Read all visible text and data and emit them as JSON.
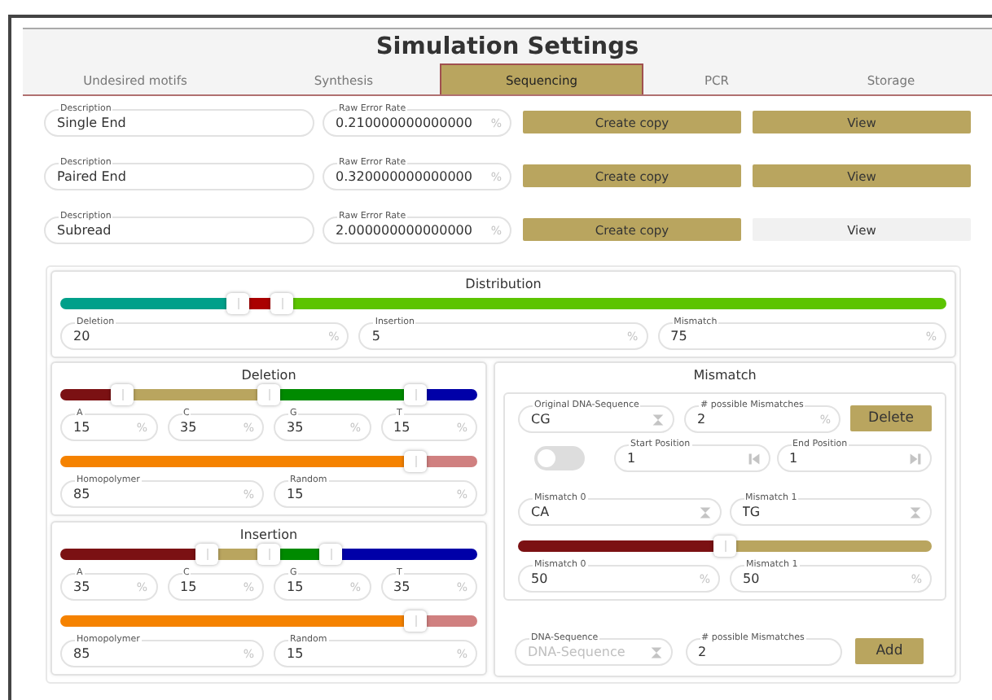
{
  "title": "Simulation Settings",
  "tabs": [
    {
      "label": "Undesired motifs",
      "selected": false
    },
    {
      "label": "Synthesis",
      "selected": false
    },
    {
      "label": "Sequencing",
      "selected": true
    },
    {
      "label": "PCR",
      "selected": false
    },
    {
      "label": "Storage",
      "selected": false
    }
  ],
  "methods": [
    {
      "description": {
        "label": "Description",
        "value": "Single End"
      },
      "error_rate": {
        "label": "Raw Error Rate",
        "value": "0.210000000000000",
        "unit": "%"
      },
      "copy_button": "Create copy",
      "view_button": {
        "label": "View",
        "disabled": false
      }
    },
    {
      "description": {
        "label": "Description",
        "value": "Paired End"
      },
      "error_rate": {
        "label": "Raw Error Rate",
        "value": "0.320000000000000",
        "unit": "%"
      },
      "copy_button": "Create copy",
      "view_button": {
        "label": "View",
        "disabled": false
      }
    },
    {
      "description": {
        "label": "Description",
        "value": "Subread"
      },
      "error_rate": {
        "label": "Raw Error Rate",
        "value": "2.000000000000000",
        "unit": "%"
      },
      "copy_button": "Create copy",
      "view_button": {
        "label": "View",
        "disabled": true
      }
    }
  ],
  "distribution": {
    "title": "Distribution",
    "track": [
      {
        "color": "#00a08a"
      },
      {
        "color": "#aa0000"
      },
      {
        "color": "#5cc400"
      }
    ],
    "handles": [
      {
        "level": 0.2
      },
      {
        "level": 0.25
      }
    ],
    "segments": [
      {
        "label": "Deletion",
        "value": "20",
        "unit": "%"
      },
      {
        "label": "Insertion",
        "value": "5",
        "unit": "%"
      },
      {
        "label": "Mismatch",
        "value": "75",
        "unit": "%"
      }
    ]
  },
  "deletion": {
    "title": "Deletion",
    "bars": [
      {
        "track": [
          {
            "color": "#7b1113"
          },
          {
            "color": "#b9a55f"
          },
          {
            "color": "#008a00"
          },
          {
            "color": "#0000a8"
          }
        ],
        "handles": [
          {
            "level": 0.15
          },
          {
            "level": 0.5
          },
          {
            "level": 0.85
          }
        ],
        "segments": [
          {
            "label": "A",
            "value": "15",
            "unit": "%"
          },
          {
            "label": "C",
            "value": "35",
            "unit": "%"
          },
          {
            "label": "G",
            "value": "35",
            "unit": "%"
          },
          {
            "label": "T",
            "value": "15",
            "unit": "%"
          }
        ]
      },
      {
        "track": [
          {
            "color": "#f58200"
          },
          {
            "color": "#d08080"
          }
        ],
        "handles": [
          {
            "level": 0.85
          }
        ],
        "segments": [
          {
            "label": "Homopolymer",
            "value": "85",
            "unit": "%"
          },
          {
            "label": "Random",
            "value": "15",
            "unit": "%"
          }
        ]
      }
    ]
  },
  "insertion": {
    "title": "Insertion",
    "bars": [
      {
        "track": [
          {
            "color": "#7b1113"
          },
          {
            "color": "#b9a55f"
          },
          {
            "color": "#008a00"
          },
          {
            "color": "#0000a8"
          }
        ],
        "handles": [
          {
            "level": 0.35
          },
          {
            "level": 0.5
          },
          {
            "level": 0.65
          }
        ],
        "segments": [
          {
            "label": "A",
            "value": "35",
            "unit": "%"
          },
          {
            "label": "C",
            "value": "15",
            "unit": "%"
          },
          {
            "label": "G",
            "value": "15",
            "unit": "%"
          },
          {
            "label": "T",
            "value": "35",
            "unit": "%"
          }
        ]
      },
      {
        "track": [
          {
            "color": "#f58200"
          },
          {
            "color": "#d08080"
          }
        ],
        "handles": [
          {
            "level": 0.85
          }
        ],
        "segments": [
          {
            "label": "Homopolymer",
            "value": "85",
            "unit": "%"
          },
          {
            "label": "Random",
            "value": "15",
            "unit": "%"
          }
        ]
      }
    ]
  },
  "mismatch": {
    "title": "Mismatch",
    "rules": [
      {
        "sequence": {
          "label": "Original DNA-Sequence",
          "value": "CG",
          "kind": "sequence"
        },
        "count": {
          "label": "# possible Mismatches",
          "value": "2",
          "unit": "%"
        },
        "delete_button": "Delete",
        "toggle_on": false,
        "start": {
          "label": "Start Position",
          "value": "1",
          "kind": "start"
        },
        "end": {
          "label": "End Position",
          "value": "1",
          "kind": "end"
        },
        "mismatches": [
          {
            "label": "Mismatch 0",
            "value": "CA",
            "kind": "sequence"
          },
          {
            "label": "Mismatch 1",
            "value": "TG",
            "kind": "sequence"
          }
        ],
        "distribution": {
          "track": [
            {
              "color": "#7b1113"
            },
            {
              "color": "#b9a55f"
            }
          ],
          "handles": [
            {
              "level": 0.5
            }
          ],
          "segments": [
            {
              "label": "Mismatch 0",
              "value": "50",
              "unit": "%"
            },
            {
              "label": "Mismatch 1",
              "value": "50",
              "unit": "%"
            }
          ]
        }
      }
    ],
    "new_rule": {
      "sequence": {
        "label": "DNA-Sequence",
        "placeholder": "DNA-Sequence",
        "kind": "sequence"
      },
      "count": {
        "label": "# possible Mismatches",
        "value": "2"
      },
      "add_button": "Add"
    }
  }
}
